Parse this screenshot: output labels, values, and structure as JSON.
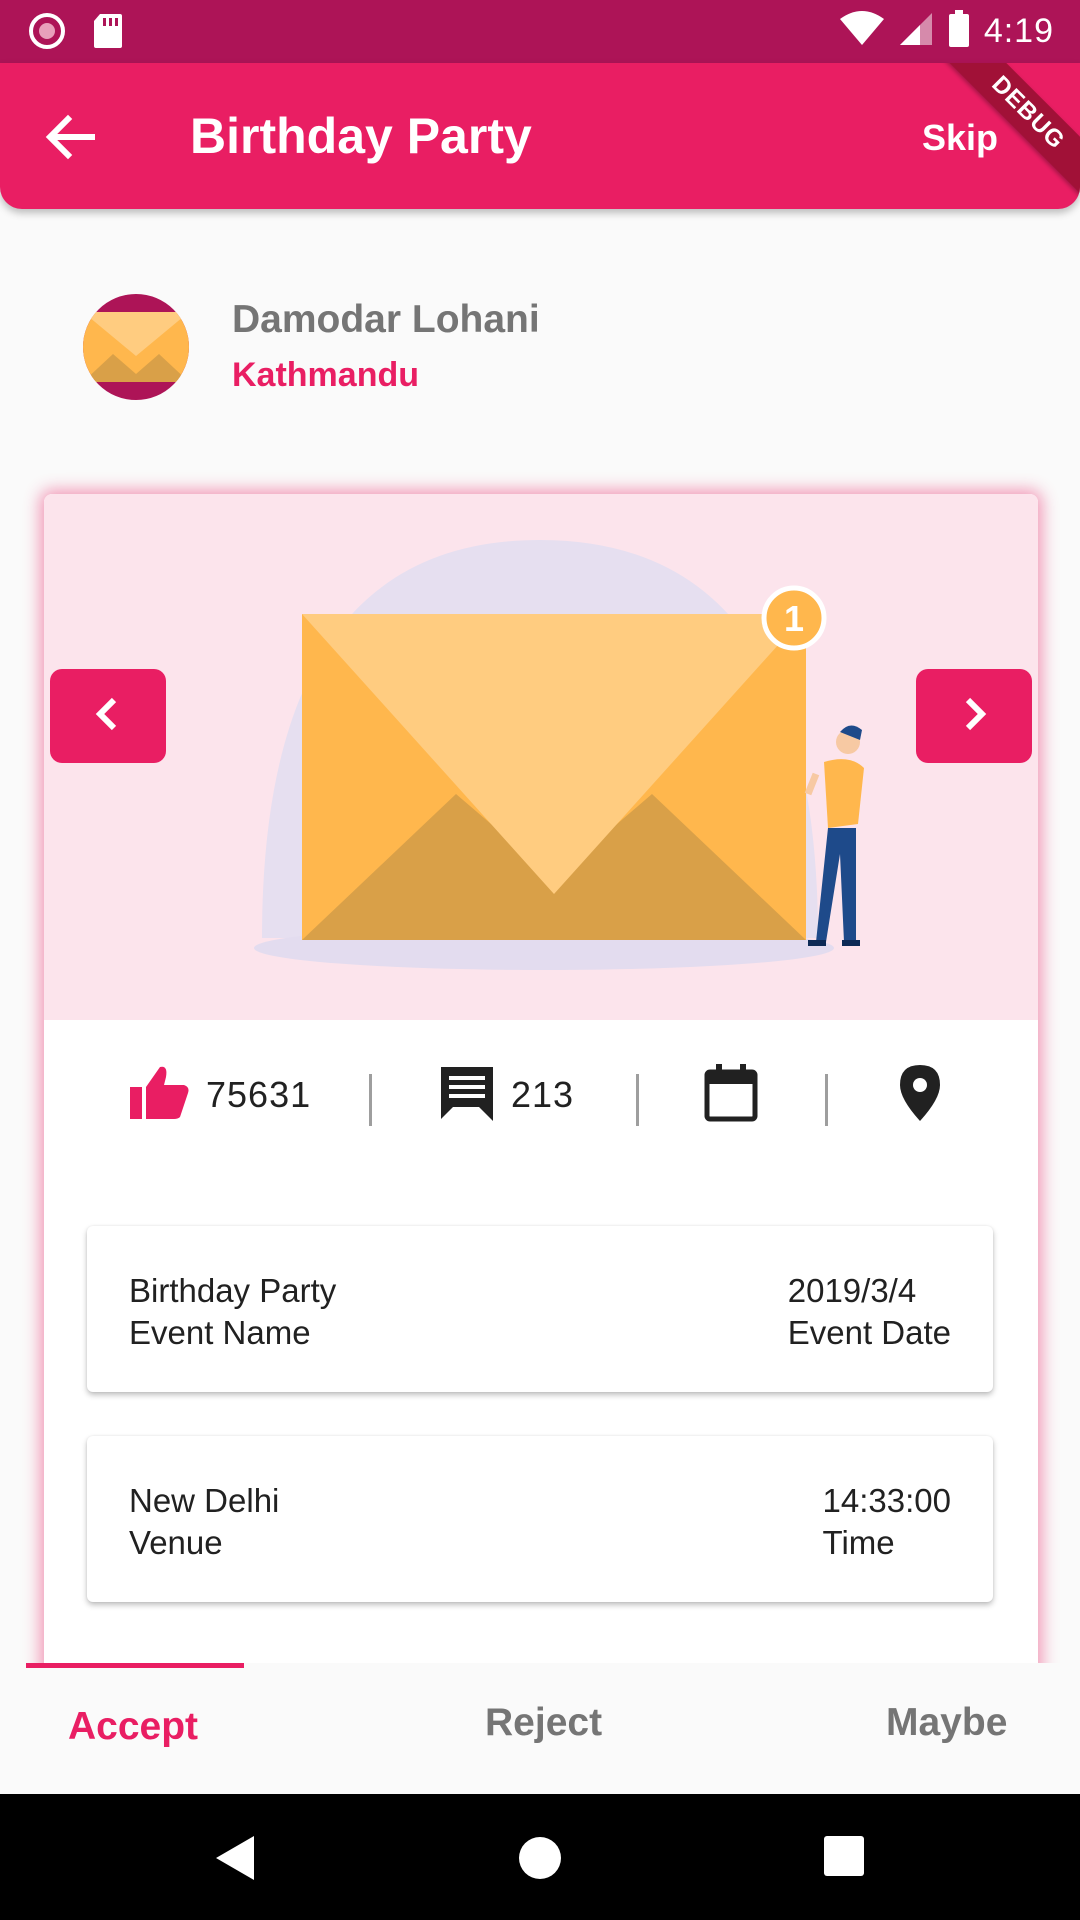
{
  "status_bar": {
    "time": "4:19",
    "icons": [
      "record-icon",
      "sd-card-icon",
      "wifi-icon",
      "signal-icon",
      "battery-icon"
    ]
  },
  "app_bar": {
    "title": "Birthday Party",
    "skip_label": "Skip",
    "debug_label": "DEBUG",
    "back_icon": "arrow-back-icon"
  },
  "profile": {
    "name": "Damodar Lohani",
    "city": "Kathmandu"
  },
  "hero": {
    "badge_count": "1",
    "prev_icon": "chevron-left-icon",
    "next_icon": "chevron-right-icon"
  },
  "stats": {
    "likes": "75631",
    "comments": "213"
  },
  "details": [
    {
      "left_value": "Birthday Party",
      "left_label": "Event Name",
      "right_value": "2019/3/4",
      "right_label": "Event Date"
    },
    {
      "left_value": "New Delhi",
      "left_label": "Venue",
      "right_value": "14:33:00",
      "right_label": "Time"
    }
  ],
  "tabs": {
    "accept": "Accept",
    "reject": "Reject",
    "maybe": "Maybe"
  },
  "colors": {
    "primary": "#e91e63",
    "status_bar": "#ad1457",
    "hero_bg": "#fce4ec"
  }
}
